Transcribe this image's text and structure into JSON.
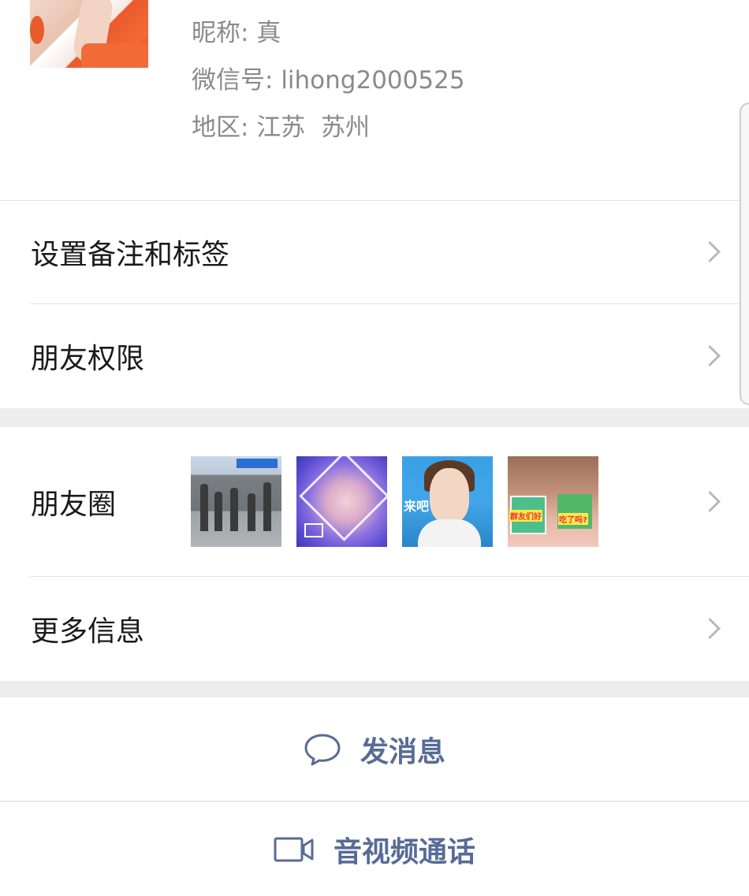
{
  "profile": {
    "nickname_label": "昵称:",
    "nickname": "真",
    "wechat_id_label": "微信号:",
    "wechat_id": "lihong2000525",
    "region_label": "地区:",
    "region": "江苏  苏州"
  },
  "settings": {
    "remark_tags": "设置备注和标签",
    "friend_permissions": "朋友权限"
  },
  "moments": {
    "label": "朋友圈",
    "thumb_texts": {
      "t3": "来吧",
      "t4a": "群友们好",
      "t4b": "吃了吗?"
    }
  },
  "more_info": {
    "label": "更多信息"
  },
  "actions": {
    "send_message": "发消息",
    "av_call": "音视频通话"
  },
  "colors": {
    "accent": "#576b95",
    "background": "#ededed",
    "card": "#ffffff"
  },
  "icons": {
    "message": "chat-bubble-icon",
    "video": "video-camera-icon",
    "chevron": "chevron-right-icon"
  }
}
